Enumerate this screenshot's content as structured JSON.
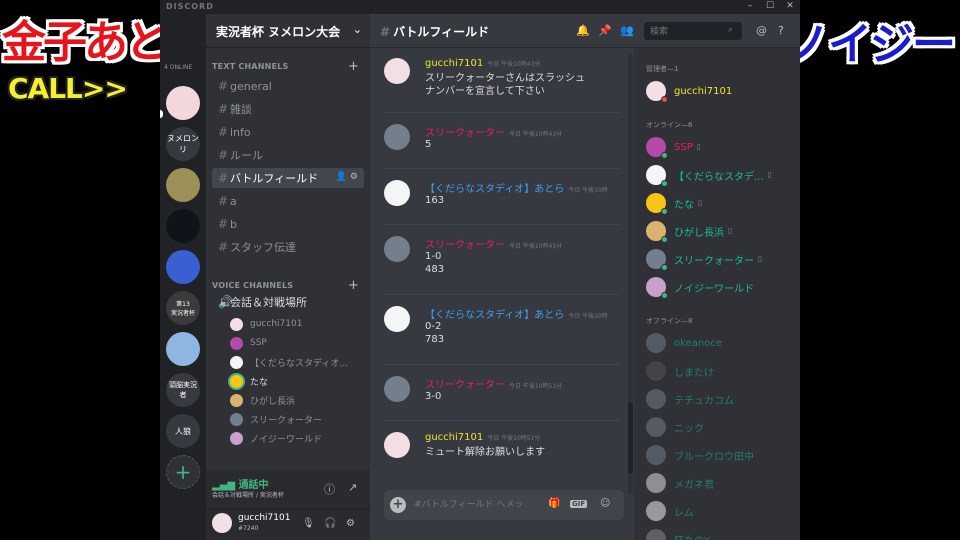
{
  "overlay": {
    "left_name": "金子あとら",
    "call_label": "CALL>>",
    "right_name": "ノイジー"
  },
  "titlebar": {
    "brand": "DISCORD",
    "minimize": "–",
    "maximize": "☐",
    "close": "✕"
  },
  "guilds": {
    "online_label": "4 ONLINE",
    "items": [
      {
        "label": "",
        "color": "#f2d7dd"
      },
      {
        "label": "ヌメロンリ",
        "color": "#36393f"
      },
      {
        "label": "",
        "color": "#9c8f58"
      },
      {
        "label": "",
        "color": "#11131a"
      },
      {
        "label": "",
        "color": "#3a5fd3"
      },
      {
        "label": "第13\n実況者杯",
        "color": "#3b3b3b"
      },
      {
        "label": "",
        "color": "#8fb6e0"
      },
      {
        "label": "頭脳実況者",
        "color": "#36393f"
      },
      {
        "label": "人狼",
        "color": "#36393f"
      },
      {
        "label": "+",
        "color": "#2f3136"
      }
    ]
  },
  "guild_header": {
    "name": "実況者杯 ヌメロン大会",
    "chevron": "⌄"
  },
  "text_category": {
    "label": "TEXT CHANNELS",
    "plus": "+"
  },
  "text_channels": [
    "general",
    "雑談",
    "info",
    "ルール",
    "バトルフィールド",
    "a",
    "b",
    "スタッフ伝達"
  ],
  "voice_category": {
    "label": "VOICE CHANNELS",
    "plus": "+"
  },
  "voice_channel": {
    "name": "会話＆対戦場所"
  },
  "voice_users": [
    {
      "name": "gucchi7101",
      "color": "#f2dfe3"
    },
    {
      "name": "SSP",
      "color": "#b24aa6"
    },
    {
      "name": "【くだらなスタディオ...",
      "color": "#f5f5f5"
    },
    {
      "name": "たな",
      "color": "#f5c518"
    },
    {
      "name": "ひがし長浜",
      "color": "#d9b36b"
    },
    {
      "name": "スリークォーター",
      "color": "#747f8d"
    },
    {
      "name": "ノイジーワールド",
      "color": "#c9a0c9"
    }
  ],
  "voicebar": {
    "status": "通話中",
    "subtitle": "会話＆対戦場所 / 実況者杯",
    "info_icon": "ⓘ",
    "disconnect_icon": "↗"
  },
  "userbar": {
    "name": "gucchi7101",
    "tag": "#7240",
    "mic_icon": "🎙",
    "headset_icon": "🎧",
    "settings_icon": "⚙"
  },
  "chat_header": {
    "channel": "バトルフィールド",
    "bell": "🔔",
    "pin": "📌",
    "members": "👥",
    "search_placeholder": "検索",
    "search_icon": "⌕",
    "mention": "@",
    "help": "?"
  },
  "messages": [
    {
      "author": "gucchi7101",
      "time": "今日 午後10時43分",
      "text": "スリークォーターさんはスラッシュ\nナンバーを宣言して下さい",
      "name_color": "#f0e428",
      "avatar_color": "#f2dfe3"
    },
    {
      "author": "スリークォーター",
      "time": "今日 午後10時43分",
      "text": "5",
      "name_color": "#e91e63",
      "avatar_color": "#747f8d"
    },
    {
      "author": "【くだらなスタディオ】あとら",
      "time": "今日 午後10時",
      "text": "163",
      "name_color": "#3ca0f0",
      "avatar_color": "#f5f5f5"
    },
    {
      "author": "スリークォーター",
      "time": "今日 午後10時45分",
      "text": "1-0\n483",
      "name_color": "#e91e63",
      "avatar_color": "#747f8d"
    },
    {
      "author": "【くだらなスタディオ】あとら",
      "time": "今日 午後10時",
      "text": "0-2\n783",
      "name_color": "#3ca0f0",
      "avatar_color": "#f5f5f5"
    },
    {
      "author": "スリークォーター",
      "time": "今日 午後10時51分",
      "text": "3-0",
      "name_color": "#e91e63",
      "avatar_color": "#747f8d"
    },
    {
      "author": "gucchi7101",
      "time": "今日 午後10時51分",
      "text": "ミュート解除お願いします",
      "name_color": "#f0e428",
      "avatar_color": "#f2dfe3"
    }
  ],
  "composer": {
    "placeholder": "#バトルフィールド へメッ",
    "plus": "+",
    "gift_icon": "🎁",
    "gif_label": "GIF",
    "emoji_icon": "☺"
  },
  "members_panel": {
    "admin_label": "管理者—1",
    "online_label": "オンライン—6",
    "offline_label": "オフライン—8",
    "admin": [
      {
        "name": "gucchi7101",
        "color": "#f0e428",
        "avatar": "#f2dfe3",
        "status": "#f04747",
        "phone": ""
      }
    ],
    "online": [
      {
        "name": "SSP",
        "color": "#e91e63",
        "avatar": "#b24aa6",
        "status": "#43b581",
        "phone": "▯"
      },
      {
        "name": "【くだらなスタデ...",
        "color": "#1abc9c",
        "avatar": "#f5f5f5",
        "status": "#43b581",
        "phone": "▯"
      },
      {
        "name": "たな",
        "color": "#1abc9c",
        "avatar": "#f5c518",
        "status": "#43b581",
        "phone": "▯"
      },
      {
        "name": "ひがし長浜",
        "color": "#1abc9c",
        "avatar": "#d9b36b",
        "status": "#43b581",
        "phone": "▯"
      },
      {
        "name": "スリークォーター",
        "color": "#1abc9c",
        "avatar": "#747f8d",
        "status": "#43b581",
        "phone": "▯"
      },
      {
        "name": "ノイジーワールド",
        "color": "#1abc9c",
        "avatar": "#c9a0c9",
        "status": "#43b581",
        "phone": ""
      }
    ],
    "offline": [
      {
        "name": "okeanoce",
        "color": "#1abc9c",
        "avatar": "#747f8d"
      },
      {
        "name": "しまたけ",
        "color": "#1abc9c",
        "avatar": "#555"
      },
      {
        "name": "テチュカコム",
        "color": "#1abc9c",
        "avatar": "#747f8d"
      },
      {
        "name": "ニック",
        "color": "#1abc9c",
        "avatar": "#747f8d"
      },
      {
        "name": "ブルークロウ田中",
        "color": "#1abc9c",
        "avatar": "#747f8d"
      },
      {
        "name": "メガネ君",
        "color": "#1abc9c",
        "avatar": "#ddd"
      },
      {
        "name": "レム",
        "color": "#1abc9c",
        "avatar": "#eee"
      },
      {
        "name": "狂丸のY",
        "color": "#1abc9c",
        "avatar": "#888"
      }
    ]
  }
}
